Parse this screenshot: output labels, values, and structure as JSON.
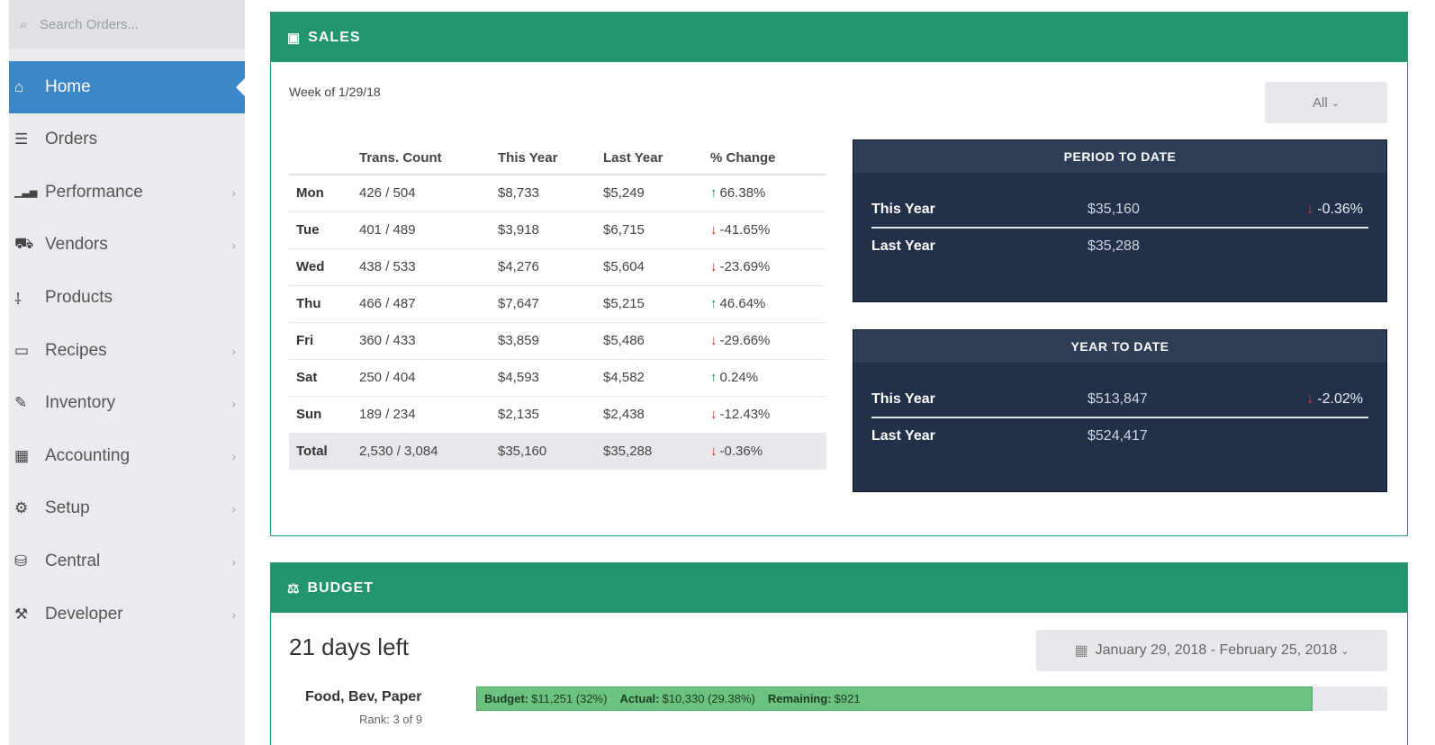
{
  "sidebar": {
    "search_placeholder": "Search Orders...",
    "items": [
      {
        "label": "Home",
        "icon": "home-icon",
        "active": true
      },
      {
        "label": "Orders",
        "icon": "list-icon"
      },
      {
        "label": "Performance",
        "icon": "bar-chart-icon"
      },
      {
        "label": "Vendors",
        "icon": "truck-icon"
      },
      {
        "label": "Products",
        "icon": "utensils-icon"
      },
      {
        "label": "Recipes",
        "icon": "card-icon"
      },
      {
        "label": "Inventory",
        "icon": "edit-icon"
      },
      {
        "label": "Accounting",
        "icon": "calculator-icon"
      },
      {
        "label": "Setup",
        "icon": "gear-icon"
      },
      {
        "label": "Central",
        "icon": "database-icon"
      },
      {
        "label": "Developer",
        "icon": "wrench-icon"
      }
    ]
  },
  "sales": {
    "title": "SALES",
    "week": "Week of 1/29/18",
    "filter": "All",
    "columns": [
      "",
      "Trans. Count",
      "This Year",
      "Last Year",
      "% Change"
    ],
    "rows": [
      {
        "day": "Mon",
        "count": "426 / 504",
        "this_year": "$8,733",
        "last_year": "$5,249",
        "change": "66.38%",
        "dir": "up"
      },
      {
        "day": "Tue",
        "count": "401 / 489",
        "this_year": "$3,918",
        "last_year": "$6,715",
        "change": "-41.65%",
        "dir": "down"
      },
      {
        "day": "Wed",
        "count": "438 / 533",
        "this_year": "$4,276",
        "last_year": "$5,604",
        "change": "-23.69%",
        "dir": "down"
      },
      {
        "day": "Thu",
        "count": "466 / 487",
        "this_year": "$7,647",
        "last_year": "$5,215",
        "change": "46.64%",
        "dir": "up"
      },
      {
        "day": "Fri",
        "count": "360 / 433",
        "this_year": "$3,859",
        "last_year": "$5,486",
        "change": "-29.66%",
        "dir": "down"
      },
      {
        "day": "Sat",
        "count": "250 / 404",
        "this_year": "$4,593",
        "last_year": "$4,582",
        "change": "0.24%",
        "dir": "up"
      },
      {
        "day": "Sun",
        "count": "189 / 234",
        "this_year": "$2,135",
        "last_year": "$2,438",
        "change": "-12.43%",
        "dir": "down"
      }
    ],
    "total": {
      "day": "Total",
      "count": "2,530 / 3,084",
      "this_year": "$35,160",
      "last_year": "$35,288",
      "change": "-0.36%",
      "dir": "down"
    },
    "period_to_date": {
      "title": "PERIOD TO DATE",
      "this_year_label": "This Year",
      "this_year_value": "$35,160",
      "change": "-0.36%",
      "last_year_label": "Last Year",
      "last_year_value": "$35,288"
    },
    "year_to_date": {
      "title": "YEAR TO DATE",
      "this_year_label": "This Year",
      "this_year_value": "$513,847",
      "change": "-2.02%",
      "last_year_label": "Last Year",
      "last_year_value": "$524,417"
    }
  },
  "budget": {
    "title": "BUDGET",
    "days_left": "21 days left",
    "date_range": "January 29, 2018 - February 25, 2018",
    "category": {
      "name": "Food, Bev, Paper",
      "rank": "Rank: 3 of 9",
      "budget_label": "Budget:",
      "budget_value": "$11,251 (32%)",
      "actual_label": "Actual:",
      "actual_value": "$10,330 (29.38%)",
      "remaining_label": "Remaining:",
      "remaining_value": "$921",
      "progress": 0.918
    }
  },
  "colors": {
    "accent_green": "#22946f",
    "active_blue": "#3c87c8",
    "dark_panel": "#22304a",
    "down_red": "#c62828",
    "up_green": "#1e8a4f",
    "budget_bar": "#6cc27f"
  }
}
